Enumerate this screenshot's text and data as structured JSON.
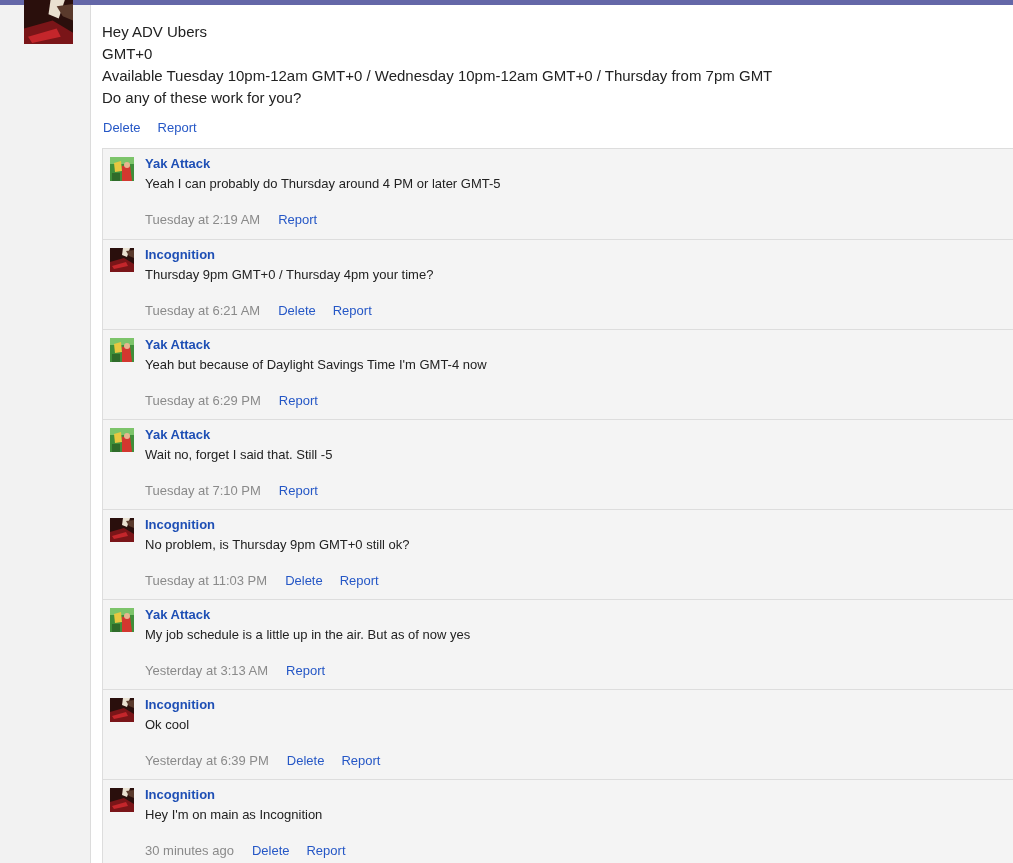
{
  "post": {
    "lines": [
      "Hey ADV Ubers",
      "GMT+0",
      "Available Tuesday 10pm-12am GMT+0 / Wednesday 10pm-12am GMT+0 / Thursday from 7pm GMT",
      "Do any of these work for you?"
    ],
    "actions": [
      "Delete",
      "Report"
    ]
  },
  "replies": [
    {
      "kind": "green",
      "author": "Yak Attack",
      "text": "Yeah I can probably do Thursday around 4 PM or later GMT-5",
      "time": "Tuesday at 2:19 AM",
      "actions": [
        "Report"
      ]
    },
    {
      "kind": "red",
      "author": "Incognition",
      "text": "Thursday 9pm GMT+0 / Thursday 4pm your time?",
      "time": "Tuesday at 6:21 AM",
      "actions": [
        "Delete",
        "Report"
      ]
    },
    {
      "kind": "green",
      "author": "Yak Attack",
      "text": "Yeah but because of Daylight Savings Time I'm GMT-4 now",
      "time": "Tuesday at 6:29 PM",
      "actions": [
        "Report"
      ]
    },
    {
      "kind": "green",
      "author": "Yak Attack",
      "text": "Wait no, forget I said that. Still -5",
      "time": "Tuesday at 7:10 PM",
      "actions": [
        "Report"
      ]
    },
    {
      "kind": "red",
      "author": "Incognition",
      "text": "No problem, is Thursday 9pm GMT+0 still ok?",
      "time": "Tuesday at 11:03 PM",
      "actions": [
        "Delete",
        "Report"
      ]
    },
    {
      "kind": "green",
      "author": "Yak Attack",
      "text": "My job schedule is a little up in the air. But as of now yes",
      "time": "Yesterday at 3:13 AM",
      "actions": [
        "Report"
      ]
    },
    {
      "kind": "red",
      "author": "Incognition",
      "text": "Ok cool",
      "time": "Yesterday at 6:39 PM",
      "actions": [
        "Delete",
        "Report"
      ]
    },
    {
      "kind": "red",
      "author": "Incognition",
      "text": "Hey I'm on main as Incognition",
      "time": "30 minutes ago",
      "actions": [
        "Delete",
        "Report"
      ]
    }
  ]
}
